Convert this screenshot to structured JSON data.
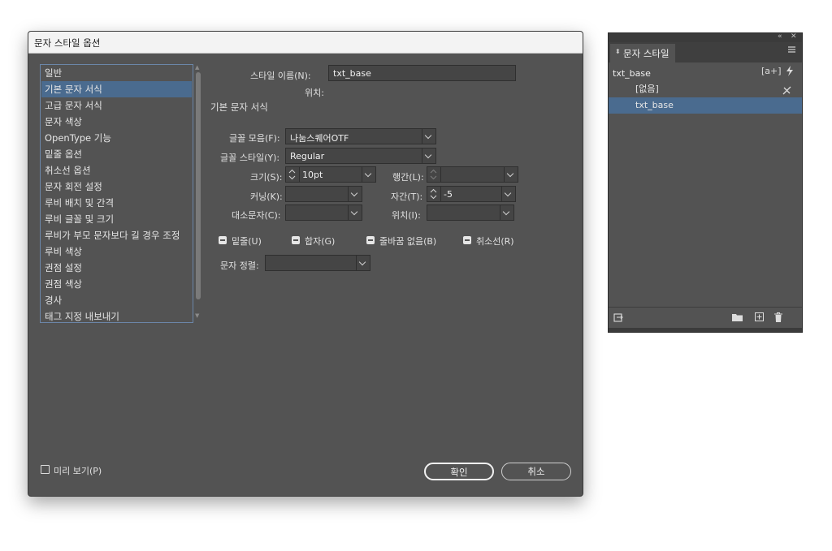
{
  "dialog": {
    "title": "문자 스타일 옵션",
    "categories": [
      "일반",
      "기본 문자 서식",
      "고급 문자 서식",
      "문자 색상",
      "OpenType 기능",
      "밑줄 옵션",
      "취소선 옵션",
      "문자 회전 설정",
      "루비 배치 및 간격",
      "루비 글꼴 및 크기",
      "루비가 부모 문자보다 길 경우 조정",
      "루비 색상",
      "권점 설정",
      "권점 색상",
      "경사",
      "태그 지정 내보내기"
    ],
    "selected_category": "기본 문자 서식",
    "style_name_label": "스타일 이름(N):",
    "style_name_value": "txt_base",
    "location_label": "위치:",
    "section_title": "기본 문자 서식",
    "font_family_label": "글꼴 모음(F):",
    "font_family_value": "나눔스퀘어OTF",
    "font_style_label": "글꼴 스타일(Y):",
    "font_style_value": "Regular",
    "size_label": "크기(S):",
    "size_value": "10pt",
    "leading_label": "행간(L):",
    "leading_value": "",
    "kerning_label": "커닝(K):",
    "kerning_value": "",
    "tracking_label": "자간(T):",
    "tracking_value": "-5",
    "case_label": "대소문자(C):",
    "case_value": "",
    "position_label": "위치(I):",
    "position_value": "",
    "underline_label": "밑줄(U)",
    "ligatures_label": "합자(G)",
    "nobreak_label": "줄바꿈 없음(B)",
    "strikethrough_label": "취소선(R)",
    "align_label": "문자 정렬:",
    "align_value": "",
    "preview_label": "미리 보기(P)",
    "ok_label": "확인",
    "cancel_label": "취소"
  },
  "panel": {
    "tab_label": "문자 스타일",
    "current_style": "txt_base",
    "styles": [
      "[없음]",
      "txt_base"
    ],
    "selected_style": "txt_base",
    "new_style_badge": "[a+]"
  },
  "colors": {
    "dialog_bg": "#535353",
    "selection": "#4a6b8f",
    "field_bg": "#454545",
    "titlebar_bg": "#f3f3f3"
  },
  "icons": [
    "chevron-down-icon",
    "spinner-icon",
    "checkbox-mixed-icon",
    "collapse-icon",
    "close-icon",
    "panel-menu-icon",
    "lightning-icon",
    "new-style-icon",
    "clear-override-icon",
    "load-styles-icon",
    "folder-icon",
    "add-icon",
    "trash-icon"
  ]
}
